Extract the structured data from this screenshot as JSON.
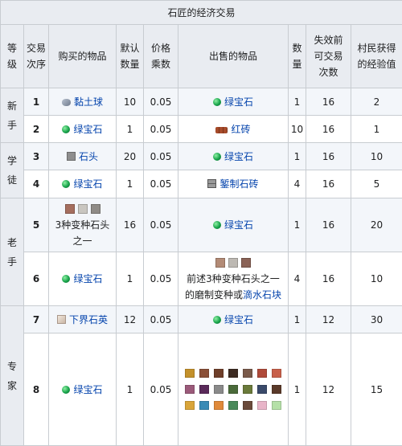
{
  "title": "石匠的经济交易",
  "headers": {
    "level": [
      "等",
      "级"
    ],
    "order": [
      "交易",
      "次序"
    ],
    "buy": "购买的物品",
    "default_qty": [
      "默认",
      "数量"
    ],
    "price_mult": [
      "价格",
      "乘数"
    ],
    "sell": "出售的物品",
    "qty": [
      "数",
      "量"
    ],
    "max_uses": [
      "失效前",
      "可交易",
      "次数"
    ],
    "xp": [
      "村民获得",
      "的经验值"
    ]
  },
  "levels": {
    "novice": [
      "新",
      "手"
    ],
    "apprentice": [
      "学",
      "徒"
    ],
    "journeyman": [
      "老",
      "手"
    ],
    "expert": [
      "专",
      "家"
    ]
  },
  "rows": [
    {
      "order": "1",
      "buy": "黏土球",
      "buy_icon": "clay-ball-icon",
      "default_qty": "10",
      "price_mult": "0.05",
      "sell": "绿宝石",
      "sell_icon": "emerald-icon",
      "qty": "1",
      "max_uses": "16",
      "xp": "2"
    },
    {
      "order": "2",
      "buy": "绿宝石",
      "buy_icon": "emerald-icon",
      "default_qty": "1",
      "price_mult": "0.05",
      "sell": "红砖",
      "sell_icon": "brick-icon",
      "qty": "10",
      "max_uses": "16",
      "xp": "1"
    },
    {
      "order": "3",
      "buy": "石头",
      "buy_icon": "stone-icon",
      "default_qty": "20",
      "price_mult": "0.05",
      "sell": "绿宝石",
      "sell_icon": "emerald-icon",
      "qty": "1",
      "max_uses": "16",
      "xp": "10"
    },
    {
      "order": "4",
      "buy": "绿宝石",
      "buy_icon": "emerald-icon",
      "default_qty": "1",
      "price_mult": "0.05",
      "sell": "錾制石砖",
      "sell_icon": "chiseled-stone-bricks-icon",
      "qty": "4",
      "max_uses": "16",
      "xp": "5"
    },
    {
      "order": "5",
      "buy": [
        "3种变种石头",
        "之一"
      ],
      "default_qty": "16",
      "price_mult": "0.05",
      "sell": "绿宝石",
      "sell_icon": "emerald-icon",
      "qty": "1",
      "max_uses": "16",
      "xp": "20"
    },
    {
      "order": "6",
      "buy": "绿宝石",
      "buy_icon": "emerald-icon",
      "default_qty": "1",
      "price_mult": "0.05",
      "sell": [
        "前述3种变种石头之一",
        "的磨制变种或",
        "滴水石块"
      ],
      "qty": "4",
      "max_uses": "16",
      "xp": "10"
    },
    {
      "order": "7",
      "buy": "下界石英",
      "buy_icon": "nether-quartz-icon",
      "default_qty": "12",
      "price_mult": "0.05",
      "sell": "绿宝石",
      "sell_icon": "emerald-icon",
      "qty": "1",
      "max_uses": "12",
      "xp": "30"
    },
    {
      "order": "8",
      "buy": "绿宝石",
      "buy_icon": "emerald-icon",
      "default_qty": "1",
      "price_mult": "0.05",
      "qty": "1",
      "max_uses": "12",
      "xp": "15"
    }
  ],
  "colors": {
    "link": "#0645ad",
    "header_bg": "#e9ecf1",
    "row_band": "#f3f6fa",
    "border": "#c8ccd1",
    "swatches_row1": [
      "#c4912b",
      "#8a4f37",
      "#6f3f2a",
      "#3d2b22",
      "#7a5a4a",
      "#b04a3a",
      "#c8604a"
    ],
    "swatches_row2": [
      "#9b5a7a",
      "#5a2a5a",
      "#8a8a8a",
      "#4a6a3a",
      "#6a7a3a",
      "#3a4a6a",
      "#5a3a2a"
    ],
    "swatches_row3": [
      "#d9a53a",
      "#3a8ab5",
      "#e08a3a",
      "#4a8a5a",
      "#6a4a3a",
      "#e8b4c8",
      "#b5e0a8"
    ]
  }
}
